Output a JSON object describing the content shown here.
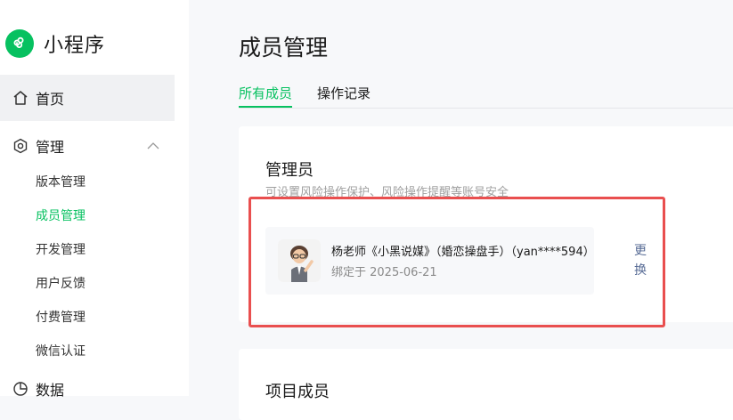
{
  "app": {
    "name": "小程序",
    "accent": "#07c160"
  },
  "sidebar": {
    "home": {
      "label": "首页",
      "icon": "home-icon"
    },
    "manage": {
      "label": "管理",
      "icon": "manage-hexagon-icon",
      "expanded": true
    },
    "manage_items": [
      {
        "label": "版本管理",
        "active": false
      },
      {
        "label": "成员管理",
        "active": true
      },
      {
        "label": "开发管理",
        "active": false
      },
      {
        "label": "用户反馈",
        "active": false
      },
      {
        "label": "付费管理",
        "active": false
      },
      {
        "label": "微信认证",
        "active": false
      }
    ],
    "data": {
      "label": "数据",
      "icon": "data-pie-icon"
    }
  },
  "main": {
    "title": "成员管理",
    "tabs": [
      {
        "label": "所有成员",
        "active": true
      },
      {
        "label": "操作记录",
        "active": false
      }
    ],
    "admin_card": {
      "title": "管理员",
      "description": "可设置风险操作保护、风险操作提醒等账号安全",
      "member": {
        "name": "杨老师《小黑说媒》（婚恋操盘手）（yan****594）",
        "bind_date": "绑定于 2025-06-21"
      },
      "change_label": "更换"
    },
    "project_card": {
      "title": "项目成员"
    }
  },
  "annotation": {
    "highlight_color": "#e94f4f"
  }
}
